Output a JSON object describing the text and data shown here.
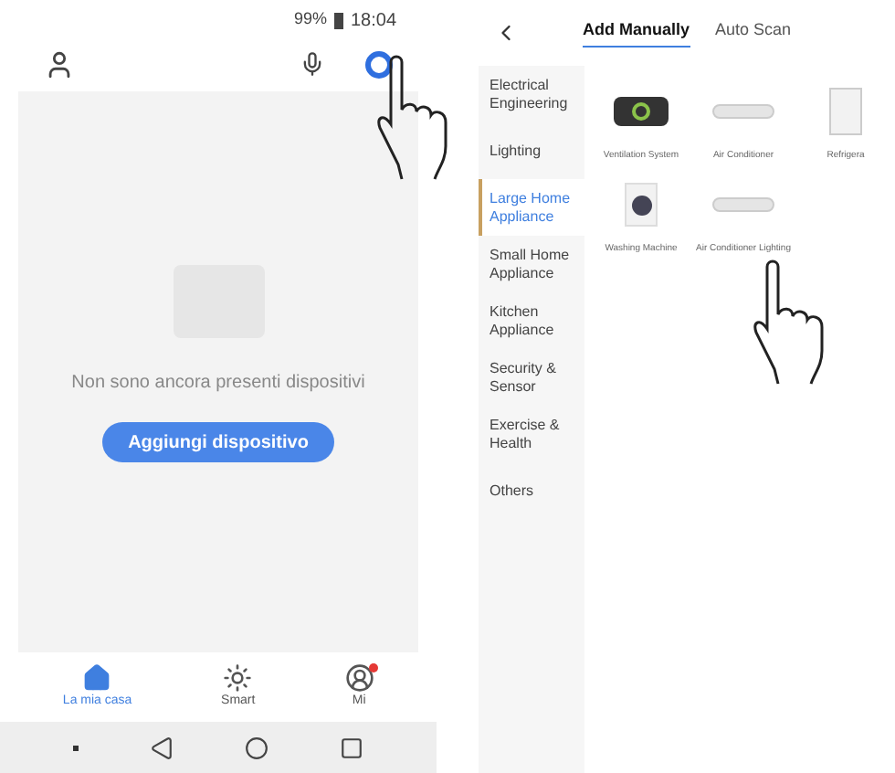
{
  "left_screen": {
    "status_bar": {
      "battery": "99%",
      "time": "18:04"
    },
    "empty_state": {
      "message": "Non sono ancora presenti dispositivi",
      "button": "Aggiungi dispositivo"
    },
    "bottom_nav": [
      {
        "label": "La mia casa",
        "kind": "home",
        "selected": true,
        "badge": false
      },
      {
        "label": "Smart",
        "kind": "smart",
        "selected": false,
        "badge": false
      },
      {
        "label": "Mi",
        "kind": "me",
        "selected": false,
        "badge": true
      }
    ]
  },
  "right_screen": {
    "tabs": [
      {
        "label": "Add Manually",
        "selected": true
      },
      {
        "label": "Auto Scan",
        "selected": false
      }
    ],
    "categories": [
      {
        "label": "Electrical Engineering",
        "selected": false
      },
      {
        "label": "Lighting",
        "selected": false
      },
      {
        "label": "Large Home Appliance",
        "selected": true
      },
      {
        "label": "Small Home Appliance",
        "selected": false
      },
      {
        "label": "Kitchen Appliance",
        "selected": false
      },
      {
        "label": "Security & Sensor",
        "selected": false
      },
      {
        "label": "Exercise & Health",
        "selected": false
      },
      {
        "label": "Others",
        "selected": false
      }
    ],
    "devices": [
      {
        "label": "Ventilation System",
        "kind": "ventilation"
      },
      {
        "label": "Air Conditioner",
        "kind": "ac"
      },
      {
        "label": "Refrigera",
        "kind": "fridge"
      },
      {
        "label": "Washing Machine",
        "kind": "washer"
      },
      {
        "label": "Air Conditioner Lighting",
        "kind": "ac"
      }
    ]
  }
}
